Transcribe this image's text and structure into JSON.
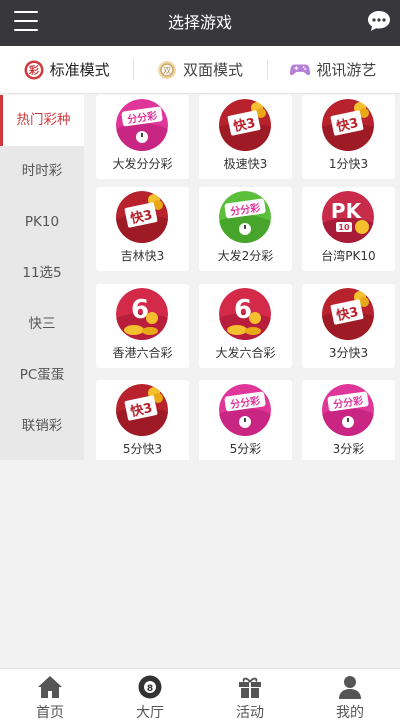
{
  "header": {
    "title": "选择游戏"
  },
  "modes": [
    {
      "label": "标准模式",
      "icon": "lottery-badge-icon",
      "active": true
    },
    {
      "label": "双面模式",
      "icon": "coin-icon",
      "active": false
    },
    {
      "label": "视讯游艺",
      "icon": "gamepad-icon",
      "active": false
    }
  ],
  "sidebar": {
    "items": [
      "热门彩种",
      "时时彩",
      "PK10",
      "11选5",
      "快三",
      "PC蛋蛋",
      "联销彩"
    ]
  },
  "games": [
    {
      "name": "大发分分彩",
      "icon": "fenfencai-icon",
      "badge": "分分彩"
    },
    {
      "name": "极速快3",
      "icon": "kuai3-icon",
      "badge": "快3"
    },
    {
      "name": "1分快3",
      "icon": "kuai3-icon",
      "badge": "快3"
    },
    {
      "name": "吉林快3",
      "icon": "kuai3-icon",
      "badge": "快3"
    },
    {
      "name": "大发2分彩",
      "icon": "fenfencai-green-icon",
      "badge": "分分彩"
    },
    {
      "name": "台湾PK10",
      "icon": "pk10-icon",
      "badge": "PK"
    },
    {
      "name": "香港六合彩",
      "icon": "liuhecai-icon",
      "badge": "6"
    },
    {
      "name": "大发六合彩",
      "icon": "liuhecai-icon",
      "badge": "6"
    },
    {
      "name": "3分快3",
      "icon": "kuai3-icon",
      "badge": "快3"
    },
    {
      "name": "5分快3",
      "icon": "kuai3-icon",
      "badge": "快3"
    },
    {
      "name": "5分彩",
      "icon": "fenfencai-icon",
      "badge": "分分彩"
    },
    {
      "name": "3分彩",
      "icon": "fenfencai-icon",
      "badge": "分分彩"
    }
  ],
  "tabbar": [
    {
      "label": "首页",
      "icon": "home-icon"
    },
    {
      "label": "大厅",
      "icon": "billiard-ball-icon"
    },
    {
      "label": "活动",
      "icon": "gift-icon"
    },
    {
      "label": "我的",
      "icon": "user-icon"
    }
  ],
  "colors": {
    "header": "#38373c",
    "accent": "#d0393e",
    "kuai3": "#b8222c",
    "fenfencai": "#e0369a",
    "green": "#5cbf3c"
  }
}
